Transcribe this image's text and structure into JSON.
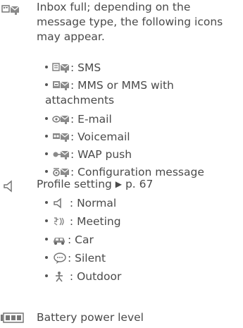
{
  "inbox": {
    "icon": "inbox-full-icon",
    "description": "Inbox full; depending on the message type, the following icons may appear.",
    "items": [
      {
        "icon": "sms-icon",
        "label": ": SMS"
      },
      {
        "icon": "mms-icon",
        "label": ": MMS or MMS with attachments"
      },
      {
        "icon": "email-icon",
        "label": ": E-mail"
      },
      {
        "icon": "voicemail-icon",
        "label": ": Voicemail"
      },
      {
        "icon": "wap-push-icon",
        "label": ": WAP push"
      },
      {
        "icon": "configuration-icon",
        "label": ": Configuration message"
      }
    ]
  },
  "profile": {
    "icon": "speaker-icon",
    "description_prefix": "Profile setting ",
    "arrow": "▶",
    "page_ref": " p. 67",
    "items": [
      {
        "icon": "normal-icon",
        "label": " : Normal"
      },
      {
        "icon": "meeting-icon",
        "label": " : Meeting"
      },
      {
        "icon": "car-icon",
        "label": ": Car"
      },
      {
        "icon": "silent-icon",
        "label": ": Silent"
      },
      {
        "icon": "outdoor-icon",
        "label": " : Outdoor"
      }
    ]
  },
  "battery": {
    "icon": "battery-icon",
    "description": "Battery power level"
  },
  "colors": {
    "text": "#4a4a4a",
    "icon": "#7a7a7a"
  }
}
